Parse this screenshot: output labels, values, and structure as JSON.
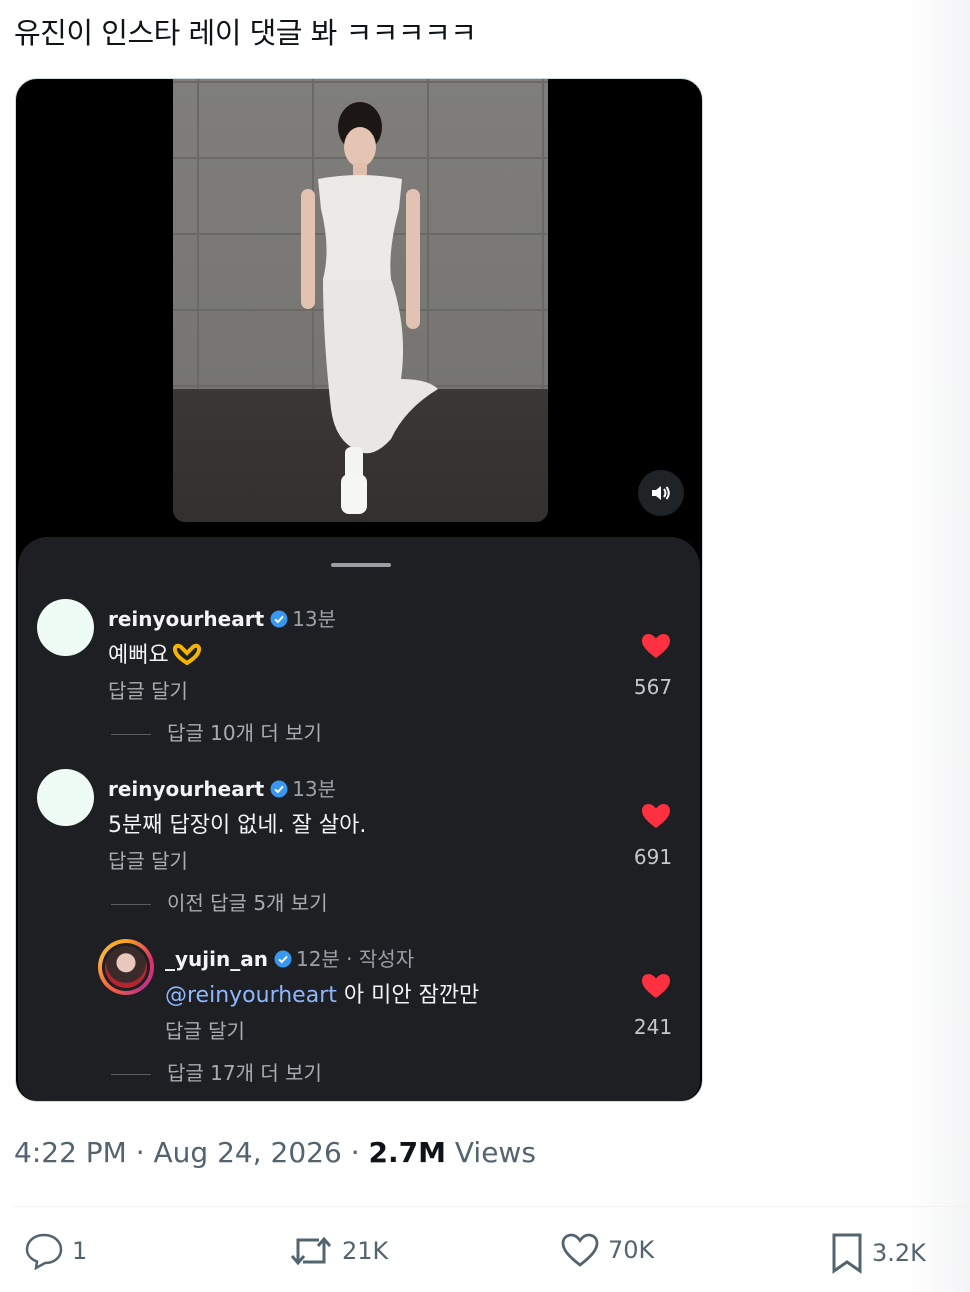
{
  "tweet": {
    "text": "유진이 인스타 레이 댓글 봐 ㅋㅋㅋㅋㅋ",
    "time": "4:22 PM",
    "date": "Aug 24, 2026",
    "views_count": "2.7M",
    "views_label": "Views"
  },
  "media": {
    "speaker_icon": "speaker-icon"
  },
  "comments": [
    {
      "user": "reinyourheart",
      "time": "13분",
      "text": "예뻐요",
      "reply_label": "답글 달기",
      "likes": "567",
      "more": "답글 10개 더 보기"
    },
    {
      "user": "reinyourheart",
      "time": "13분",
      "text": "5분째 답장이 없네. 잘 살아.",
      "reply_label": "답글 달기",
      "likes": "691",
      "more": "이전 답글 5개 보기"
    },
    {
      "user": "_yujin_an",
      "time": "12분 · 작성자",
      "mention": "@reinyourheart",
      "text": " 아 미안 잠깐만",
      "reply_label": "답글 달기",
      "likes": "241",
      "more": "답글 17개 더 보기"
    }
  ],
  "actions": {
    "replies": "1",
    "reposts": "21K",
    "likes": "70K",
    "bookmarks": "3.2K"
  },
  "colors": {
    "sheet": "#1d1f23",
    "heart": "#ff3040",
    "verified": "#3897f0",
    "mention": "#8fb7ff"
  }
}
